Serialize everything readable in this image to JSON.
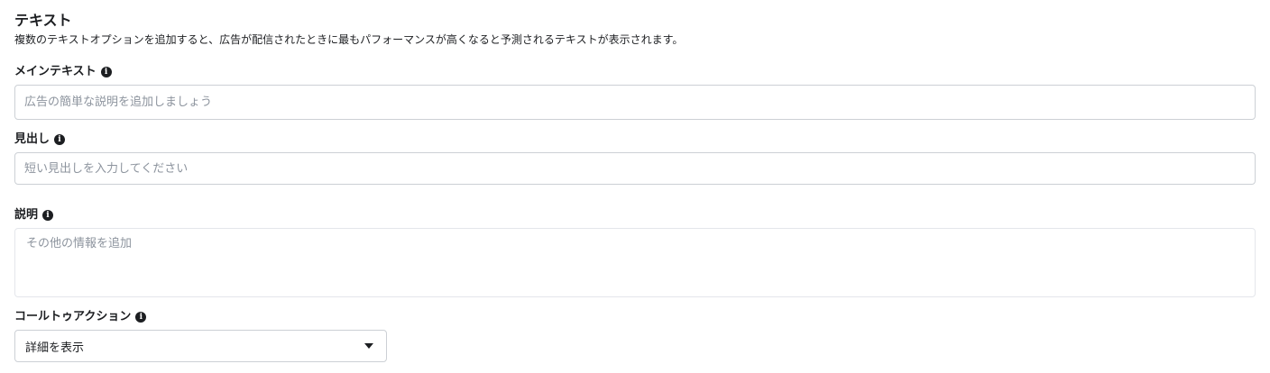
{
  "section": {
    "title": "テキスト",
    "description": "複数のテキストオプションを追加すると、広告が配信されたときに最もパフォーマンスが高くなると予測されるテキストが表示されます。"
  },
  "fields": {
    "primary_text": {
      "label": "メインテキスト",
      "placeholder": "広告の簡単な説明を追加しましょう",
      "value": ""
    },
    "headline": {
      "label": "見出し",
      "placeholder": "短い見出しを入力してください",
      "value": ""
    },
    "description": {
      "label": "説明",
      "placeholder": "その他の情報を追加",
      "value": ""
    },
    "call_to_action": {
      "label": "コールトゥアクション",
      "selected": "詳細を表示"
    }
  },
  "icons": {
    "info": "info-icon",
    "dropdown": "chevron-down-icon"
  },
  "info_glyph": "i"
}
